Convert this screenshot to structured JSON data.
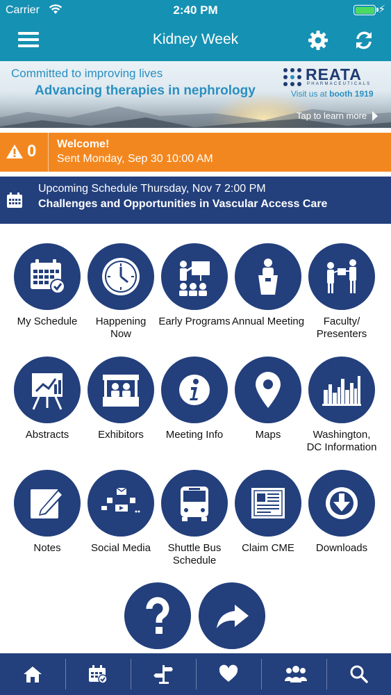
{
  "status_bar": {
    "carrier": "Carrier",
    "time": "2:40 PM",
    "battery_level": 1.0
  },
  "nav": {
    "title": "Kidney Week",
    "menu_icon": "hamburger-icon",
    "settings_icon": "gear-icon",
    "refresh_icon": "refresh-icon"
  },
  "banner": {
    "tagline1": "Committed to improving lives",
    "tagline2": "Advancing therapies in nephrology",
    "brand": "REATA",
    "brand_sub": "PHARMACEUTICALS",
    "booth_prefix": "Visit us at ",
    "booth": "booth 1919",
    "cta": "Tap to learn more"
  },
  "alert": {
    "count": "0",
    "title": "Welcome!",
    "subtitle": "Sent Monday, Sep 30 10:00 AM",
    "color": "#f3871f"
  },
  "upcoming": {
    "line1": "Upcoming Schedule Thursday, Nov 7 2:00 PM",
    "line2": "Challenges and Opportunities in Vascular Access Care"
  },
  "tiles": [
    {
      "label": "My Schedule",
      "icon": "calendar-check-icon"
    },
    {
      "label": "Happening Now",
      "icon": "clock-icon"
    },
    {
      "label": "Early Programs",
      "icon": "presentation-icon"
    },
    {
      "label": "Annual Meeting",
      "icon": "podium-icon"
    },
    {
      "label": "Faculty/ Presenters",
      "icon": "presenters-icon"
    },
    {
      "label": "Abstracts",
      "icon": "easel-chart-icon"
    },
    {
      "label": "Exhibitors",
      "icon": "booth-icon"
    },
    {
      "label": "Meeting Info",
      "icon": "info-icon"
    },
    {
      "label": "Maps",
      "icon": "map-pin-icon"
    },
    {
      "label": "Washington, DC Information",
      "icon": "city-skyline-icon"
    },
    {
      "label": "Notes",
      "icon": "note-pencil-icon"
    },
    {
      "label": "Social Media",
      "icon": "social-media-icon"
    },
    {
      "label": "Shuttle Bus Schedule",
      "icon": "bus-icon"
    },
    {
      "label": "Claim CME",
      "icon": "certificate-icon"
    },
    {
      "label": "Downloads",
      "icon": "download-icon"
    }
  ],
  "extra_buttons": [
    {
      "icon": "help-icon"
    },
    {
      "icon": "share-icon"
    }
  ],
  "tabbar": [
    {
      "icon": "home-icon"
    },
    {
      "icon": "calendar-icon"
    },
    {
      "icon": "signpost-icon"
    },
    {
      "icon": "heart-icon"
    },
    {
      "icon": "people-icon"
    },
    {
      "icon": "search-icon"
    }
  ],
  "colors": {
    "header": "#1591b3",
    "navy": "#233f7c",
    "alert": "#f3871f"
  }
}
